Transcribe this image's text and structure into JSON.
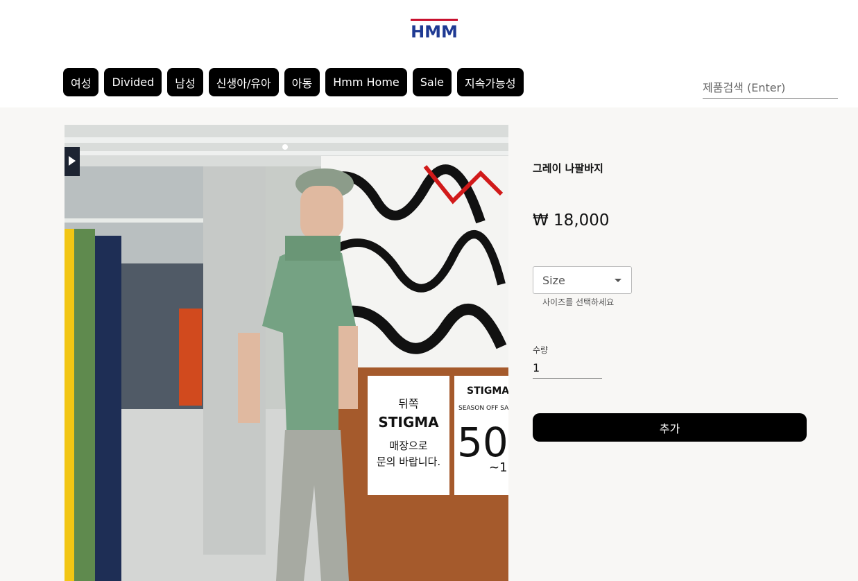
{
  "header": {
    "logo_text": "HMM",
    "nav": [
      {
        "label": "여성"
      },
      {
        "label": "Divided"
      },
      {
        "label": "남성"
      },
      {
        "label": "신생아/유아"
      },
      {
        "label": "아동"
      },
      {
        "label": "Hmm Home"
      },
      {
        "label": "Sale"
      },
      {
        "label": "지속가능성"
      }
    ],
    "search": {
      "placeholder": "제품검색 (Enter)",
      "value": ""
    }
  },
  "product": {
    "title": "그레이 나팔바지",
    "price": "₩ 18,000",
    "size_select": {
      "selected": "Size",
      "help": "사이즈를 선택하세요"
    },
    "quantity": {
      "label": "수량",
      "value": "1"
    },
    "add_button": "추가",
    "image_text": {
      "sign1_line1": "뒤쪽",
      "sign1_line2": "STIGMA",
      "sign1_line3": "매장으로",
      "sign1_line4": "문의 바랍니다.",
      "sign2_brand": "STIGMA",
      "sign2_sub": "SEASON OFF SA",
      "sign2_big": "50",
      "sign2_small": "~1"
    }
  },
  "colors": {
    "logo_red": "#c8102e",
    "logo_blue": "#1f3a93",
    "button_bg": "#000000",
    "main_bg": "#f8f7f5"
  }
}
